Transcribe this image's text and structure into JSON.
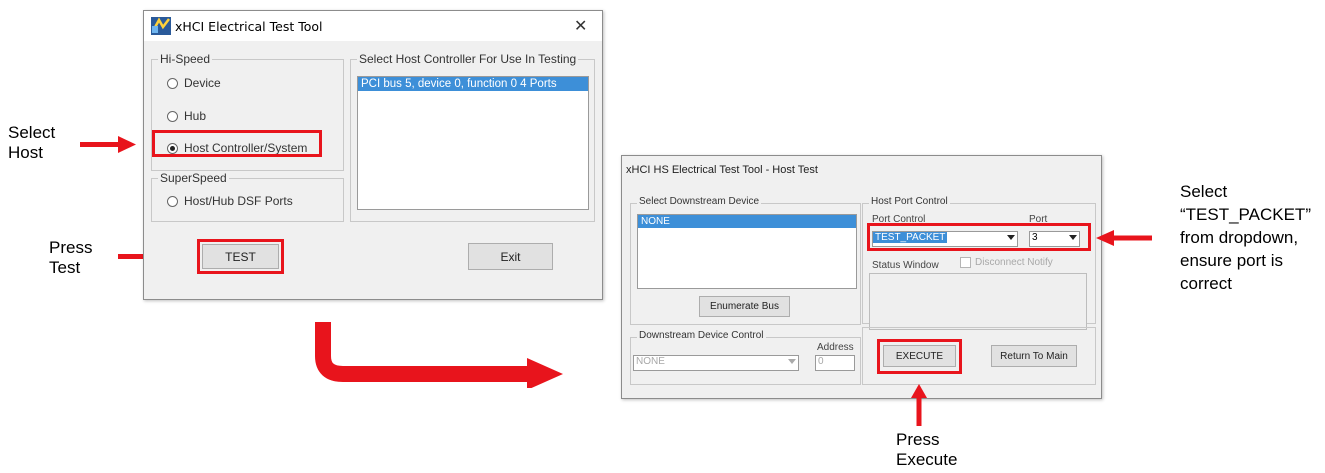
{
  "annotations": {
    "select_host": [
      "Select",
      "Host"
    ],
    "press_test": [
      "Press",
      "Test"
    ],
    "select_test_packet": [
      "Select",
      "“TEST_PACKET”",
      "from dropdown,",
      "ensure port is",
      "correct"
    ],
    "press_execute": [
      "Press",
      "Execute"
    ],
    "red": "#e8141c"
  },
  "window1": {
    "title": "xHCI Electrical Test Tool",
    "close_glyph": "✕",
    "hispeed": {
      "label": "Hi-Speed",
      "options": [
        "Device",
        "Hub",
        "Host Controller/System"
      ],
      "selected": "Host Controller/System"
    },
    "superspeed": {
      "label": "SuperSpeed",
      "options": [
        "Host/Hub DSF Ports"
      ]
    },
    "host_controller": {
      "label": "Select Host Controller For Use In Testing",
      "items": [
        "PCI bus 5, device 0, function 0  4 Ports"
      ]
    },
    "test_label": "TEST",
    "exit_label": "Exit"
  },
  "window2": {
    "title": "xHCI HS Electrical Test Tool - Host Test",
    "downstream": {
      "label": "Select Downstream Device",
      "items": [
        "NONE"
      ],
      "enumerate_label": "Enumerate Bus"
    },
    "ds_control": {
      "label": "Downstream Device Control",
      "address_label": "Address",
      "device_value": "NONE",
      "address_value": "0"
    },
    "host_port": {
      "label": "Host Port Control",
      "port_control_label": "Port Control",
      "port_label": "Port",
      "port_control_value": "TEST_PACKET",
      "port_value": "3",
      "status_label": "Status Window",
      "disconnect_label": "Disconnect Notify"
    },
    "execute_label": "EXECUTE",
    "return_label": "Return To Main"
  }
}
